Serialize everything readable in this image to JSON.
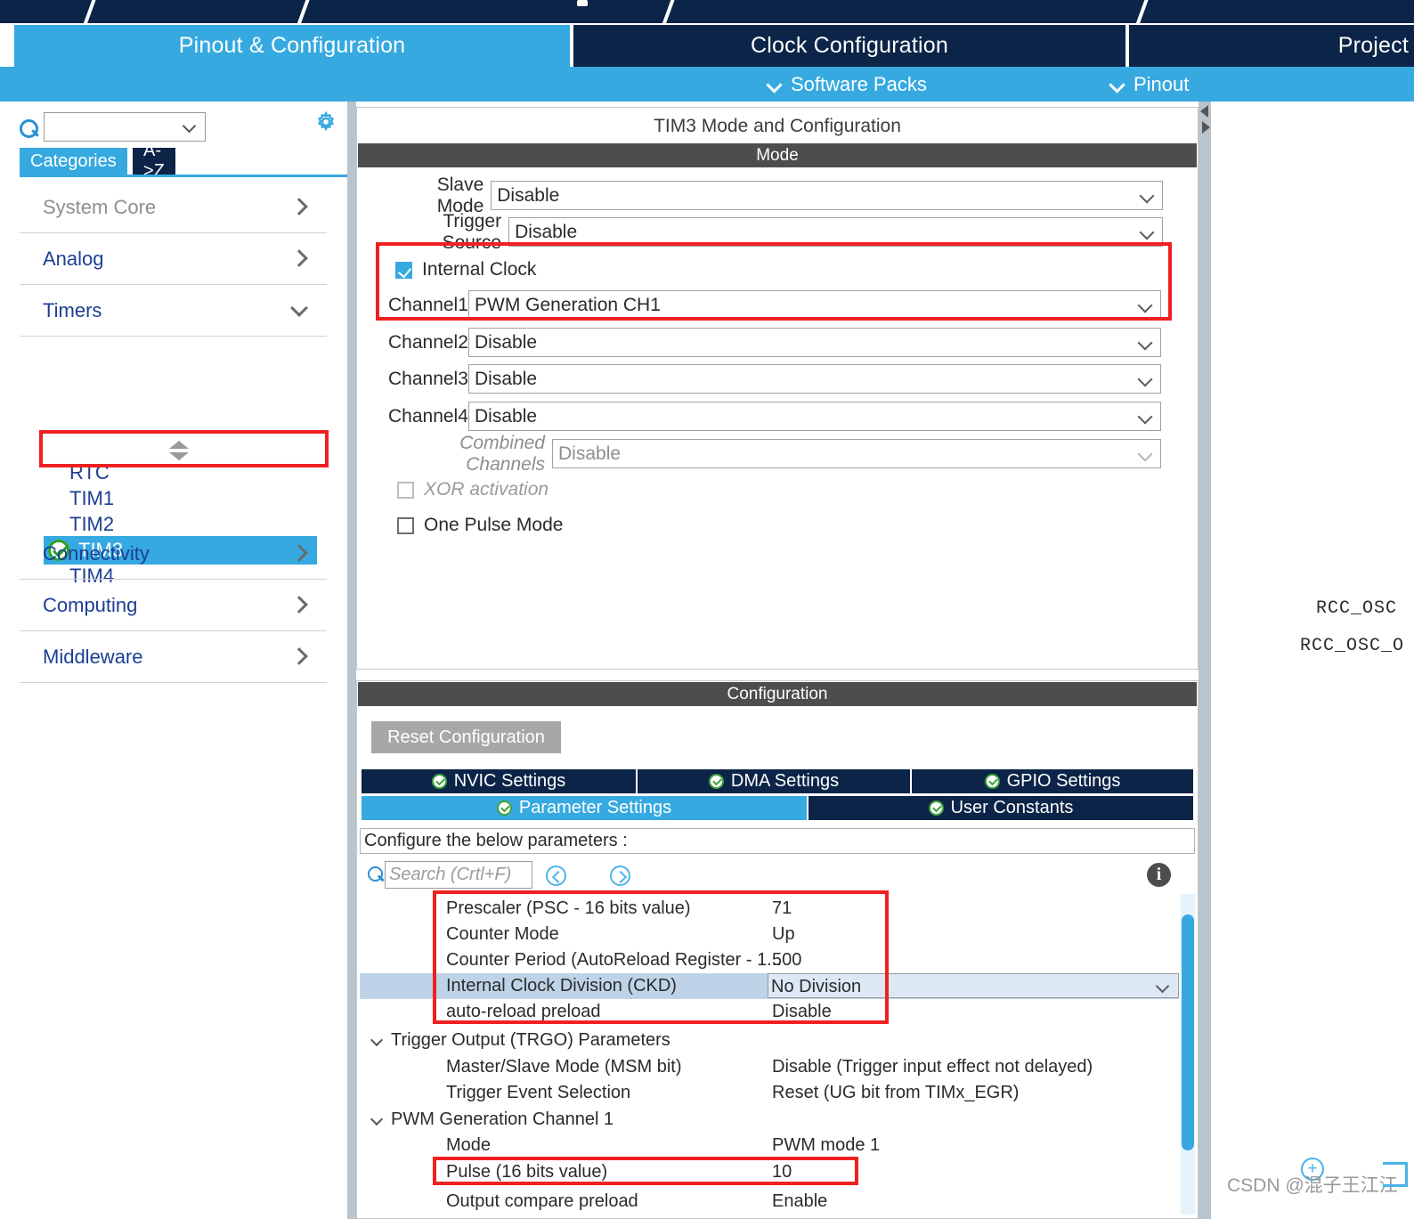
{
  "main_tabs": [
    {
      "label": "Pinout & Configuration",
      "selected": true
    },
    {
      "label": "Clock Configuration",
      "selected": false
    },
    {
      "label": "Project",
      "selected": false
    }
  ],
  "sub_bar": [
    {
      "label": "Software Packs",
      "icon": "chevron-down-icon"
    },
    {
      "label": "Pinout",
      "icon": "chevron-down-icon"
    }
  ],
  "sidebar": {
    "search_value": "",
    "gear_icon": "gear-icon",
    "search_icon": "search-icon",
    "tabs": [
      {
        "label": "Categories",
        "active": true
      },
      {
        "label": "A->Z",
        "active": false
      }
    ],
    "categories": [
      {
        "label": "System Core",
        "state": "collapsed",
        "dim": true
      },
      {
        "label": "Analog",
        "state": "collapsed",
        "dim": false
      },
      {
        "label": "Timers",
        "state": "expanded",
        "dim": false
      }
    ],
    "timers": [
      "RTC",
      "TIM1",
      "TIM2",
      "TIM4"
    ],
    "selected_timer": {
      "label": "TIM3",
      "status_icon": "check-circle-icon"
    },
    "categories_bottom": [
      {
        "label": "Connectivity",
        "state": "collapsed"
      },
      {
        "label": "Computing",
        "state": "collapsed"
      },
      {
        "label": "Middleware",
        "state": "collapsed"
      }
    ]
  },
  "mode_panel": {
    "title": "TIM3 Mode and Configuration",
    "section_header": "Mode",
    "fields": [
      {
        "label": "Slave Mode",
        "value": "Disable",
        "disabled": false
      },
      {
        "label": "Trigger Source",
        "value": "Disable",
        "disabled": false
      },
      {
        "label": "Channel1",
        "value": "PWM Generation CH1",
        "disabled": false
      },
      {
        "label": "Channel2",
        "value": "Disable",
        "disabled": false
      },
      {
        "label": "Channel3",
        "value": "Disable",
        "disabled": false
      },
      {
        "label": "Channel4",
        "value": "Disable",
        "disabled": false
      },
      {
        "label": "Combined Channels",
        "value": "Disable",
        "disabled": true
      }
    ],
    "checkboxes": [
      {
        "label": "Internal Clock",
        "checked": true,
        "disabled": false
      },
      {
        "label": "XOR activation",
        "checked": false,
        "disabled": true
      },
      {
        "label": "One Pulse Mode",
        "checked": false,
        "disabled": false
      }
    ]
  },
  "config_panel": {
    "section_header": "Configuration",
    "reset_button": "Reset Configuration",
    "tabs_row1": [
      {
        "label": "NVIC Settings",
        "active": false
      },
      {
        "label": "DMA Settings",
        "active": false
      },
      {
        "label": "GPIO Settings",
        "active": false
      }
    ],
    "tabs_row2": [
      {
        "label": "Parameter Settings",
        "active": true
      },
      {
        "label": "User Constants",
        "active": false
      }
    ],
    "note": "Configure the below parameters :",
    "search_placeholder": "Search (Crtl+F)",
    "nav_prev_icon": "prev-circle-icon",
    "nav_next_icon": "next-circle-icon",
    "info_icon": "info-icon",
    "parameters": [
      {
        "name": "Prescaler (PSC - 16 bits value)",
        "value": "71",
        "type": "row"
      },
      {
        "name": "Counter Mode",
        "value": "Up",
        "type": "row"
      },
      {
        "name": "Counter Period (AutoReload Register - 1...",
        "value": "500",
        "type": "row"
      },
      {
        "name": "Internal Clock Division (CKD)",
        "value": "No Division",
        "type": "row",
        "selected": true
      },
      {
        "name": "auto-reload preload",
        "value": "Disable",
        "type": "row"
      },
      {
        "name": "Trigger Output (TRGO) Parameters",
        "value": "",
        "type": "group"
      },
      {
        "name": "Master/Slave Mode (MSM bit)",
        "value": "Disable (Trigger input effect not delayed)",
        "type": "row"
      },
      {
        "name": "Trigger Event Selection",
        "value": "Reset (UG bit from TIMx_EGR)",
        "type": "row"
      },
      {
        "name": "PWM Generation Channel 1",
        "value": "",
        "type": "group"
      },
      {
        "name": "Mode",
        "value": "PWM mode 1",
        "type": "row"
      },
      {
        "name": "Pulse (16 bits value)",
        "value": "10",
        "type": "row"
      },
      {
        "name": "Output compare preload",
        "value": "Enable",
        "type": "row"
      }
    ]
  },
  "right_area": {
    "labels": [
      "RCC_OSC",
      "RCC_OSC_O"
    ]
  },
  "watermark": {
    "text": "CSDN @混子王江江",
    "plus_icon": "plus-circle-icon"
  },
  "colors": {
    "accent_blue": "#36a9e0",
    "navy": "#0b2447",
    "highlight_red": "#ef2020",
    "header_gray": "#4d4d4d",
    "selection_blue": "#bed3e8"
  }
}
